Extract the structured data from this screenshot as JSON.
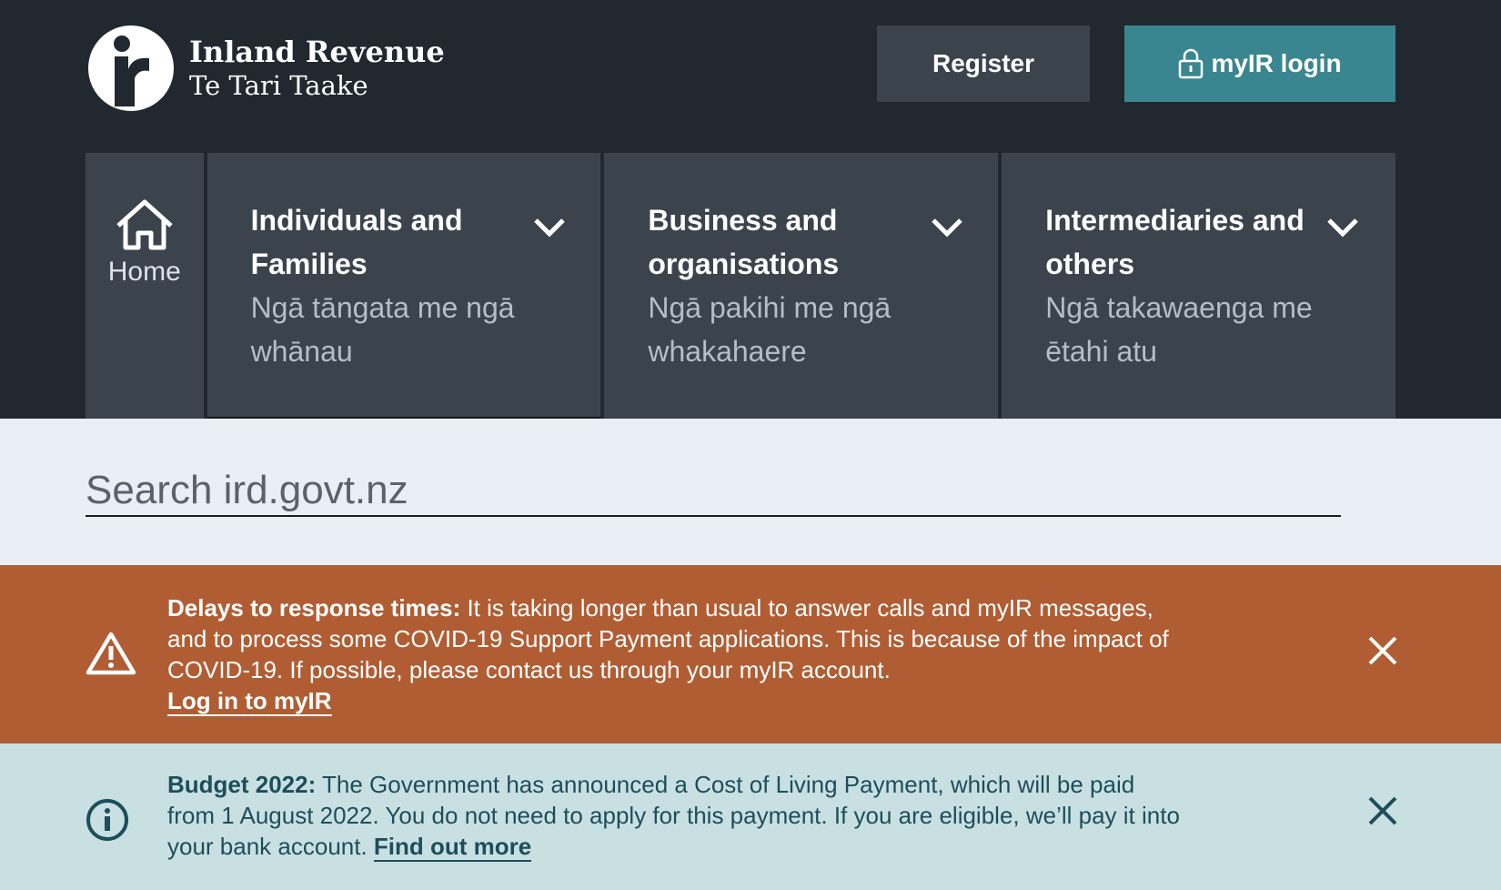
{
  "header": {
    "logo_title": "Inland Revenue",
    "logo_subtitle": "Te Tari Taake",
    "register_label": "Register",
    "login_label": "myIR login",
    "login_color": "#3a8690"
  },
  "nav": {
    "home_label": "Home",
    "items": [
      {
        "title": "Individuals and Families",
        "subtitle": "Ngā tāngata me ngā whānau"
      },
      {
        "title": "Business and organisations",
        "subtitle": "Ngā pakihi me ngā whakahaere"
      },
      {
        "title": "Intermediaries and others",
        "subtitle": "Ngā takawaenga me ētahi atu"
      }
    ]
  },
  "search": {
    "placeholder": "Search ird.govt.nz"
  },
  "alerts": {
    "warning": {
      "heading": "Delays to response times:",
      "body": " It is taking longer than usual to answer calls and myIR messages, and to process some COVID-19 Support Payment applications. This is because of the impact of COVID-19. If possible, please contact us through your myIR account.",
      "link": "Log in to myIR",
      "color": "#b05d34"
    },
    "info": {
      "heading": "Budget 2022:",
      "body": " The Government has announced a Cost of Living Payment, which will be paid from 1 August 2022. You do not need to apply for this payment. If you are eligible, we’ll pay it into your bank account. ",
      "link": "Find out more",
      "color": "#c9e0e3"
    }
  }
}
